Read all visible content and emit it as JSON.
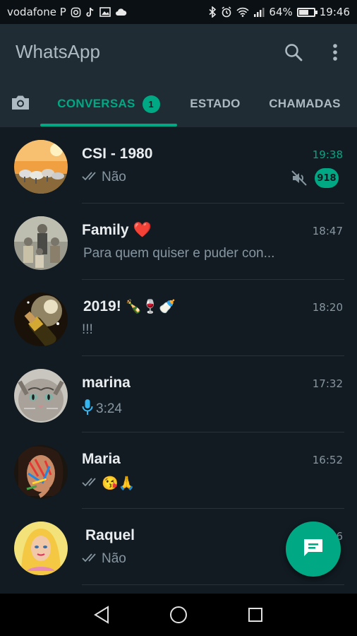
{
  "status_bar": {
    "carrier": "vodafone P",
    "battery": "64%",
    "battery_level": 0.64,
    "time": "19:46"
  },
  "app_bar": {
    "title": "WhatsApp",
    "icons": [
      "search-icon",
      "more-vertical-icon"
    ]
  },
  "tabs": [
    {
      "label": "CONVERSAS",
      "badge": "1",
      "active": true
    },
    {
      "label": "ESTADO",
      "active": false
    },
    {
      "label": "CHAMADAS",
      "active": false
    }
  ],
  "chats": [
    {
      "name": "CSI - 1980",
      "time": "19:38",
      "preview": "Não",
      "unread": "918",
      "muted": true,
      "ticks": true,
      "time_color": "#00a884"
    },
    {
      "name": "Family",
      "name_emoji": "❤️",
      "time": "18:47",
      "preview": "Para quem quiser e puder con..."
    },
    {
      "name": "2019!",
      "name_emoji": "🍾🍷🍼",
      "time": "18:20",
      "preview": "!!!"
    },
    {
      "name": "marina",
      "time": "17:32",
      "preview": "3:24",
      "voice": true
    },
    {
      "name": "Maria",
      "time": "16:52",
      "preview": "😘🙏",
      "ticks": true
    },
    {
      "name": "Raquel",
      "time": "16",
      "preview": "Não",
      "ticks": true
    }
  ],
  "colors": {
    "accent": "#00a884",
    "background": "#121b22",
    "appbar": "#1f2c34"
  }
}
